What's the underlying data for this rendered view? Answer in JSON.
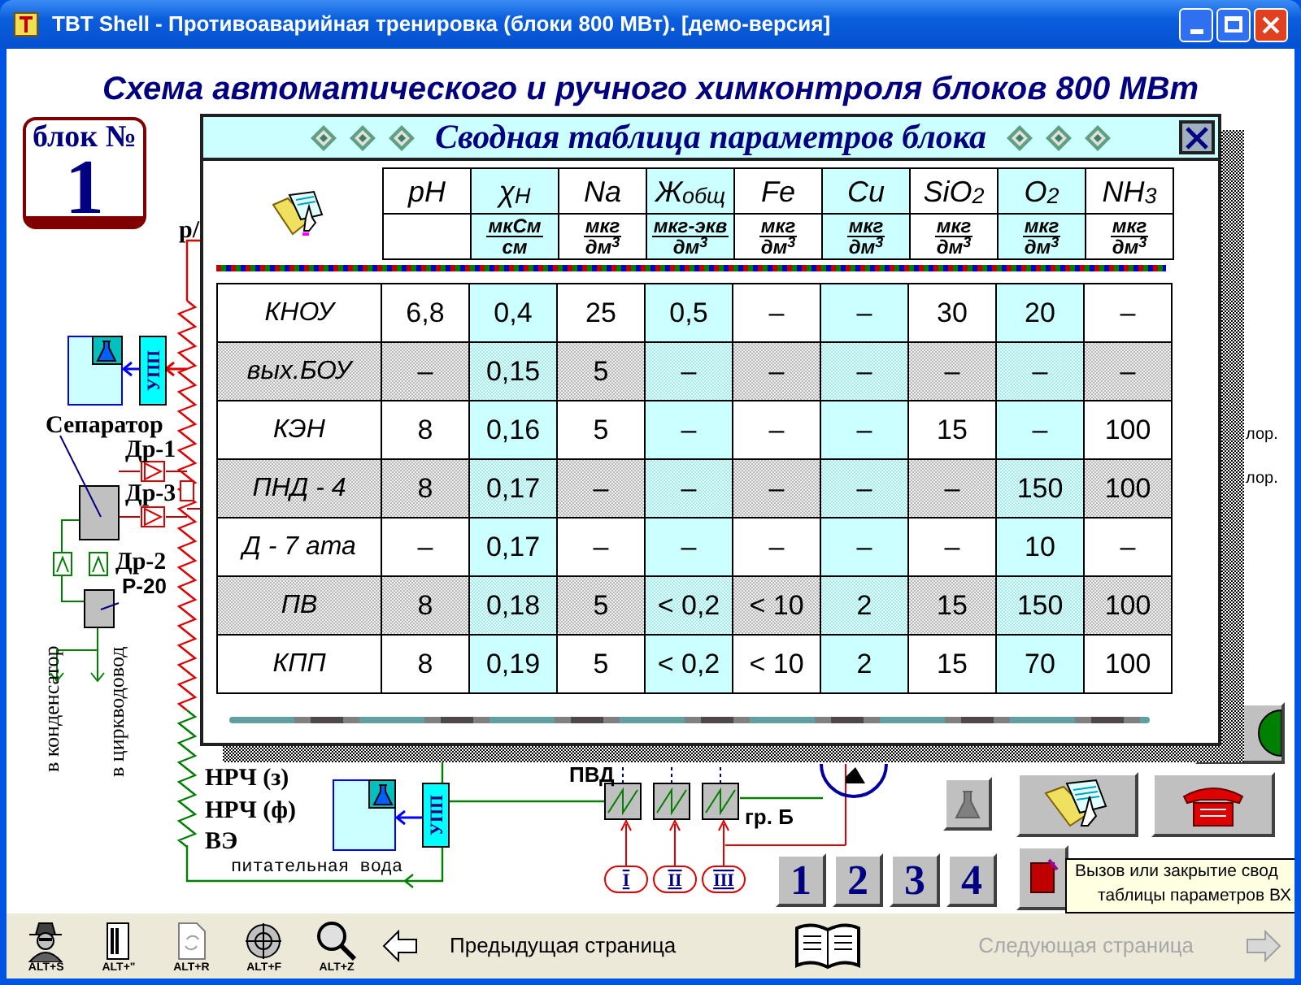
{
  "window": {
    "title": "TBT Shell - Противоаварийная тренировка (блоки 800 МВт). [демо-версия]"
  },
  "heading": "Схема автоматического и ручного химконтроля блоков 800 МВт",
  "block": {
    "label": "блок №",
    "number": "1"
  },
  "diagram": {
    "labels": [
      "р/",
      "Сепаратор",
      "Др-1",
      "Др-3",
      "Др-2",
      "Р-20",
      "в конденсатор",
      "в циркводовод",
      "НРЧ (з)",
      "НРЧ (ф)",
      "ВЭ",
      "питательная вода",
      "ПВД",
      "гр. Б",
      "лор.",
      "лор."
    ],
    "upp_labels": [
      "УПП",
      "УПП"
    ],
    "heater_inputs": [
      "I",
      "II",
      "III"
    ]
  },
  "summary": {
    "title": "Сводная таблица параметров блока",
    "columns": [
      {
        "name": "pH",
        "highlighted": false
      },
      {
        "name": "χ$_{H}$",
        "unit_top": "мкСм",
        "unit_bottom": "см",
        "highlighted": true
      },
      {
        "name": "Na",
        "unit_top": "мкг",
        "unit_bottom": "дм$^{3}$",
        "highlighted": false
      },
      {
        "name": "Ж$_{общ}$",
        "unit_top": "мкг-экв",
        "unit_bottom": "дм$^{3}$",
        "highlighted": true
      },
      {
        "name": "Fe",
        "unit_top": "мкг",
        "unit_bottom": "дм$^{3}$",
        "highlighted": false
      },
      {
        "name": "Cu",
        "unit_top": "мкг",
        "unit_bottom": "дм$^{3}$",
        "highlighted": true
      },
      {
        "name": "SiO$_{2}$",
        "unit_top": "мкг",
        "unit_bottom": "дм$^{3}$",
        "highlighted": false
      },
      {
        "name": "O$_{2}$",
        "unit_top": "мкг",
        "unit_bottom": "дм$^{3}$",
        "highlighted": true
      },
      {
        "name": "NH$_{3}$",
        "unit_top": "мкг",
        "unit_bottom": "дм$^{3}$",
        "highlighted": false
      }
    ],
    "rows": [
      {
        "label": "КНОУ",
        "shaded": false,
        "values": [
          "6,8",
          "0,4",
          "25",
          "0,5",
          "–",
          "–",
          "30",
          "20",
          "–"
        ]
      },
      {
        "label": "вых.БОУ",
        "shaded": true,
        "values": [
          "–",
          "0,15",
          "5",
          "–",
          "–",
          "–",
          "–",
          "–",
          "–"
        ]
      },
      {
        "label": "КЭН",
        "shaded": false,
        "values": [
          "8",
          "0,16",
          "5",
          "–",
          "–",
          "–",
          "15",
          "–",
          "100"
        ]
      },
      {
        "label": "ПНД - 4",
        "shaded": true,
        "values": [
          "8",
          "0,17",
          "–",
          "–",
          "–",
          "–",
          "–",
          "150",
          "100"
        ]
      },
      {
        "label": "Д - 7 ата",
        "shaded": false,
        "values": [
          "–",
          "0,17",
          "–",
          "–",
          "–",
          "–",
          "–",
          "10",
          "–"
        ]
      },
      {
        "label": "ПВ",
        "shaded": true,
        "values": [
          "8",
          "0,18",
          "5",
          "< 0,2",
          "< 10",
          "2",
          "15",
          "150",
          "100"
        ]
      },
      {
        "label": "КПП",
        "shaded": false,
        "values": [
          "8",
          "0,19",
          "5",
          "< 0,2",
          "< 10",
          "2",
          "15",
          "70",
          "100"
        ]
      }
    ]
  },
  "page_buttons": [
    "1",
    "2",
    "3",
    "4"
  ],
  "tooltip": [
    "Вызов или закрытие свод",
    "таблицы параметров ВХ"
  ],
  "toolbar": {
    "hotkeys": [
      "ALT+S",
      "ALT+\"",
      "ALT+R",
      "ALT+F",
      "ALT+Z"
    ],
    "prev": {
      "label": "Предыдущая страница",
      "disabled": false
    },
    "next": {
      "label": "Следующая страница",
      "disabled": true
    }
  }
}
